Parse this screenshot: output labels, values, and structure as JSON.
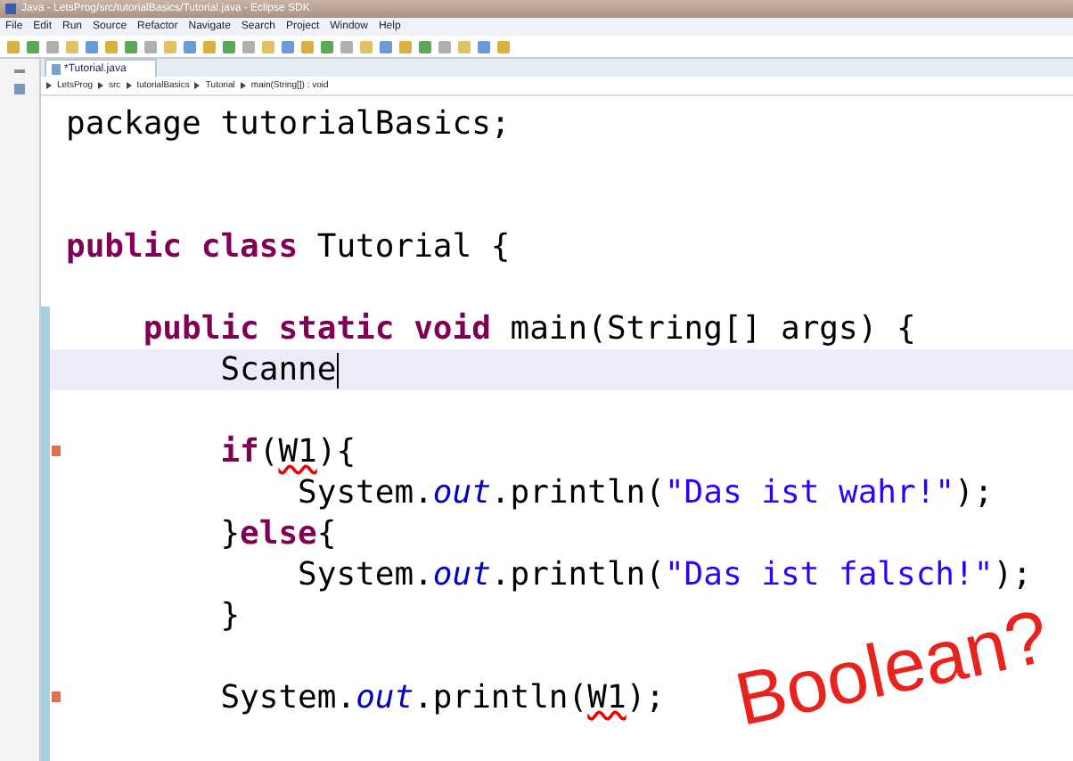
{
  "window": {
    "title": "Java - LetsProg/src/tutorialBasics/Tutorial.java - Eclipse SDK"
  },
  "menu": [
    "File",
    "Edit",
    "Run",
    "Source",
    "Refactor",
    "Navigate",
    "Search",
    "Project",
    "Window",
    "Help"
  ],
  "tabs": [
    {
      "label": "*Tutorial.java",
      "selected": true
    }
  ],
  "breadcrumb": [
    "LetsProg",
    "src",
    "tutorialBasics",
    "Tutorial",
    "main(String[]) : void"
  ],
  "code_lines": [
    {
      "current": false,
      "error": false,
      "tokens": [
        {
          "kind": "text",
          "text": "package tutorialBasics;"
        }
      ]
    },
    {
      "current": false,
      "error": false
    },
    {
      "current": false,
      "error": false
    },
    {
      "current": false,
      "error": false,
      "tokens": [
        {
          "kind": "keyword",
          "text": "public class"
        },
        {
          "kind": "text",
          "text": " Tutorial {"
        }
      ]
    },
    {
      "current": false,
      "error": false
    },
    {
      "current": false,
      "error": false,
      "tokens": [
        {
          "kind": "keyword",
          "text": "    public static void"
        },
        {
          "kind": "text",
          "text": " main(String[] args) {"
        }
      ]
    },
    {
      "current": true,
      "error": false,
      "tokens": [
        {
          "kind": "text",
          "text": "        Scanne"
        }
      ]
    },
    {
      "current": false,
      "error": false
    },
    {
      "current": false,
      "error": true,
      "tokens": [
        {
          "kind": "keyword",
          "text": "        if"
        },
        {
          "kind": "text",
          "text": "("
        },
        {
          "kind": "error",
          "text": "W1"
        },
        {
          "kind": "text",
          "text": "){"
        }
      ]
    },
    {
      "current": false,
      "error": false,
      "tokens": [
        {
          "kind": "text",
          "text": "            System."
        },
        {
          "kind": "field",
          "text": "out"
        },
        {
          "kind": "text",
          "text": ".println("
        },
        {
          "kind": "string",
          "text": "\"Das ist wahr!\""
        },
        {
          "kind": "text",
          "text": ");"
        }
      ]
    },
    {
      "current": false,
      "error": false,
      "tokens": [
        {
          "kind": "text",
          "text": "        }"
        },
        {
          "kind": "keyword",
          "text": "else"
        },
        {
          "kind": "text",
          "text": "{"
        }
      ]
    },
    {
      "current": false,
      "error": false,
      "tokens": [
        {
          "kind": "text",
          "text": "            System."
        },
        {
          "kind": "field",
          "text": "out"
        },
        {
          "kind": "text",
          "text": ".println("
        },
        {
          "kind": "string",
          "text": "\"Das ist falsch!\""
        },
        {
          "kind": "text",
          "text": ");"
        }
      ]
    },
    {
      "current": false,
      "error": false,
      "tokens": [
        {
          "kind": "text",
          "text": "        }"
        }
      ]
    },
    {
      "current": false,
      "error": false
    },
    {
      "current": false,
      "error": true,
      "tokens": [
        {
          "kind": "text",
          "text": "        System."
        },
        {
          "kind": "field",
          "text": "out"
        },
        {
          "kind": "text",
          "text": ".println("
        },
        {
          "kind": "error",
          "text": "W1"
        },
        {
          "kind": "text",
          "text": ");"
        }
      ]
    }
  ],
  "overlay_text": "Boolean?"
}
